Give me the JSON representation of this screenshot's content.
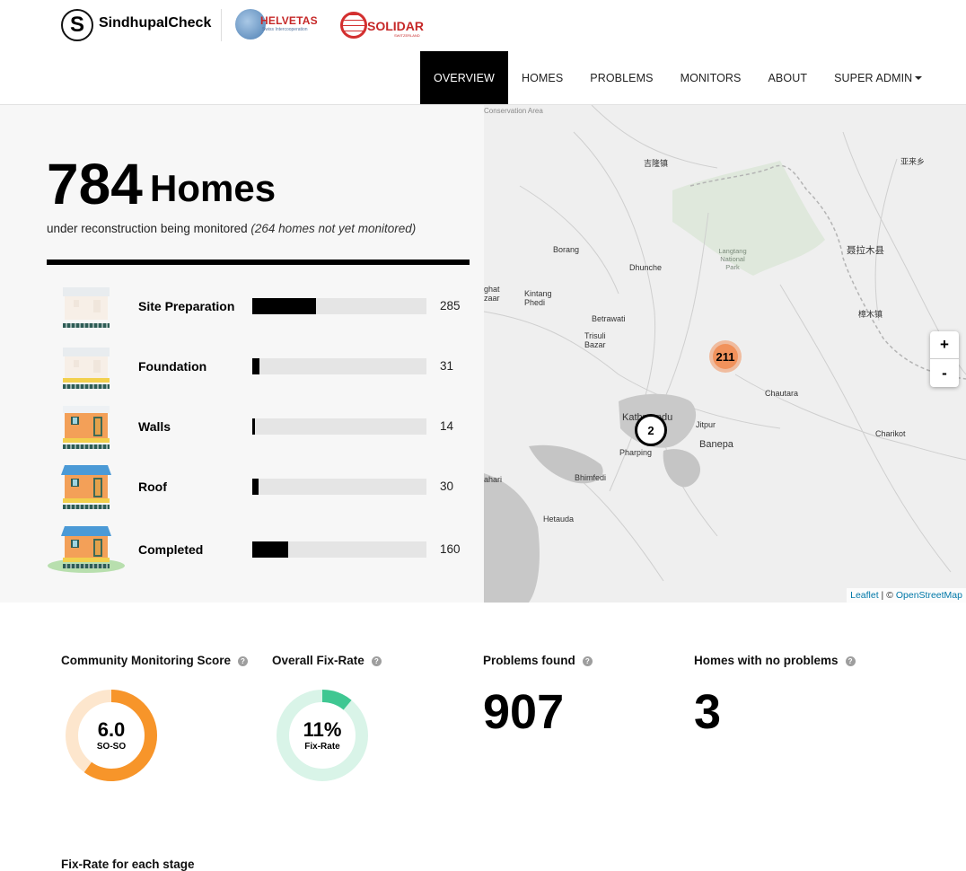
{
  "brand": {
    "logo_letter": "S",
    "name": "SindhupalCheck"
  },
  "partners": {
    "helvetas": {
      "name": "HELVETAS",
      "sub": "Swiss Intercooperation"
    },
    "solidar": {
      "name": "SOLIDAR",
      "sub": "SWITZERLAND"
    }
  },
  "nav": {
    "items": [
      {
        "label": "OVERVIEW",
        "active": true
      },
      {
        "label": "HOMES",
        "active": false
      },
      {
        "label": "PROBLEMS",
        "active": false
      },
      {
        "label": "MONITORS",
        "active": false
      },
      {
        "label": "ABOUT",
        "active": false
      },
      {
        "label": "SUPER ADMIN",
        "active": false,
        "dropdown": true
      }
    ]
  },
  "summary": {
    "home_count": "784",
    "home_word": "Homes",
    "monitored_text": "under reconstruction being monitored",
    "not_monitored_text": "(264 homes not yet monitored)",
    "stages": [
      {
        "label": "Site Preparation",
        "count": "285",
        "fraction": 0.3635
      },
      {
        "label": "Foundation",
        "count": "31",
        "fraction": 0.0395
      },
      {
        "label": "Walls",
        "count": "14",
        "fraction": 0.0179
      },
      {
        "label": "Roof",
        "count": "30",
        "fraction": 0.0383
      },
      {
        "label": "Completed",
        "count": "160",
        "fraction": 0.2041
      }
    ]
  },
  "map": {
    "labels": [
      "Conservation Area",
      "吉隆镇",
      "亚来乡",
      "Borang",
      "Dhunche",
      "Langtang National Park",
      "聂拉木县",
      "Kintang Phedi",
      "ghat",
      "zaar",
      "樟木镇",
      "Betrawati",
      "Trisuli Bazar",
      "Chautara",
      "Kathmandu",
      "Jitpur",
      "Banepa",
      "Charikot",
      "Pharping",
      "ahari",
      "Bhimfedi",
      "Hetauda"
    ],
    "clusters": [
      {
        "count": "211"
      },
      {
        "count": "2"
      }
    ],
    "zoom_in": "+",
    "zoom_out": "-",
    "attribution": {
      "leaflet": "Leaflet",
      "separator": " | © ",
      "osm": "OpenStreetMap"
    }
  },
  "stats": {
    "community_score": {
      "title": "Community Monitoring Score",
      "value": "6.0",
      "label": "SO-SO",
      "fraction": 0.6,
      "color": "#f7952a",
      "track": "#fde6cd"
    },
    "fix_rate": {
      "title": "Overall Fix-Rate",
      "value": "11%",
      "label": "Fix-Rate",
      "fraction": 0.11,
      "color": "#3fc792",
      "track": "#d9f4e8"
    },
    "problems_found": {
      "title": "Problems found",
      "value": "907"
    },
    "no_problems": {
      "title": "Homes with no problems",
      "value": "3"
    },
    "help_icon": "?",
    "next_section_title": "Fix-Rate for each stage"
  }
}
